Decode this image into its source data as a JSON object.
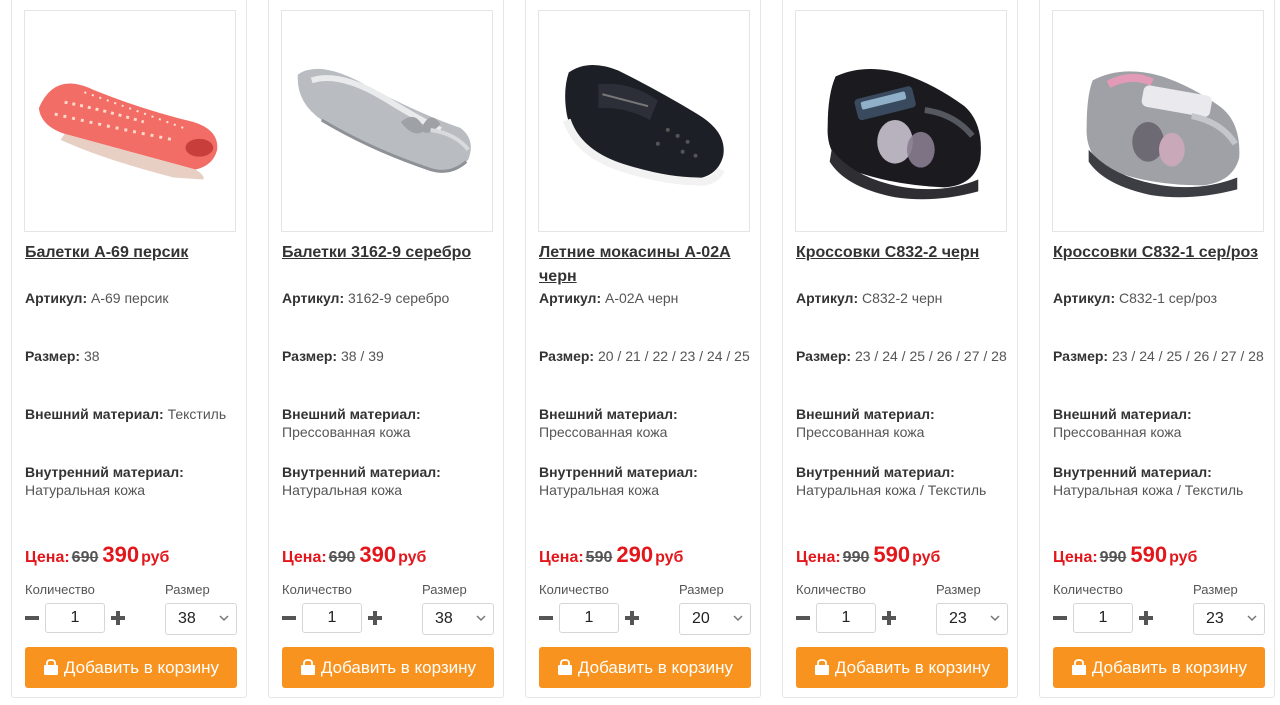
{
  "labels": {
    "article": "Артикул:",
    "size": "Размер:",
    "outer": "Внешний материал:",
    "inner": "Внутренний материал:",
    "price": "Цена:",
    "currency": "руб",
    "quantity": "Количество",
    "size_select": "Размер",
    "add_to_cart": "Добавить в корзину"
  },
  "colors": {
    "price_red": "#e3161b",
    "button_orange": "#f7931e"
  },
  "products": [
    {
      "title": "Балетки А-69 персик",
      "article": "А-69 персик",
      "sizes": "38",
      "outer": "Текстиль",
      "inner": "Натуральная кожа",
      "old_price": "690",
      "price": "390",
      "qty": "1",
      "size_selected": "38",
      "image": "coral-ballet-flat"
    },
    {
      "title": "Балетки 3162-9 серебро",
      "article": "3162-9 серебро",
      "sizes": "38 / 39",
      "outer": "Прессованная кожа",
      "inner": "Натуральная кожа",
      "old_price": "690",
      "price": "390",
      "qty": "1",
      "size_selected": "38",
      "image": "silver-ballet-flat"
    },
    {
      "title": "Летние мокасины А-02А черн",
      "article": "А-02А черн",
      "sizes": "20 / 21 / 22 / 23 / 24 / 25",
      "outer": "Прессованная кожа",
      "inner": "Натуральная кожа",
      "old_price": "590",
      "price": "290",
      "qty": "1",
      "size_selected": "20",
      "image": "black-moccasin"
    },
    {
      "title": "Кроссовки С832-2 черн",
      "article": "С832-2 черн",
      "sizes": "23 / 24 / 25 / 26 / 27 / 28",
      "outer": "Прессованная кожа",
      "inner": "Натуральная кожа / Текстиль",
      "old_price": "990",
      "price": "590",
      "qty": "1",
      "size_selected": "23",
      "image": "black-sneaker"
    },
    {
      "title": "Кроссовки С832-1 сер/роз",
      "article": "С832-1 сер/роз",
      "sizes": "23 / 24 / 25 / 26 / 27 / 28",
      "outer": "Прессованная кожа",
      "inner": "Натуральная кожа / Текстиль",
      "old_price": "990",
      "price": "590",
      "qty": "1",
      "size_selected": "23",
      "image": "grey-pink-sneaker"
    }
  ]
}
